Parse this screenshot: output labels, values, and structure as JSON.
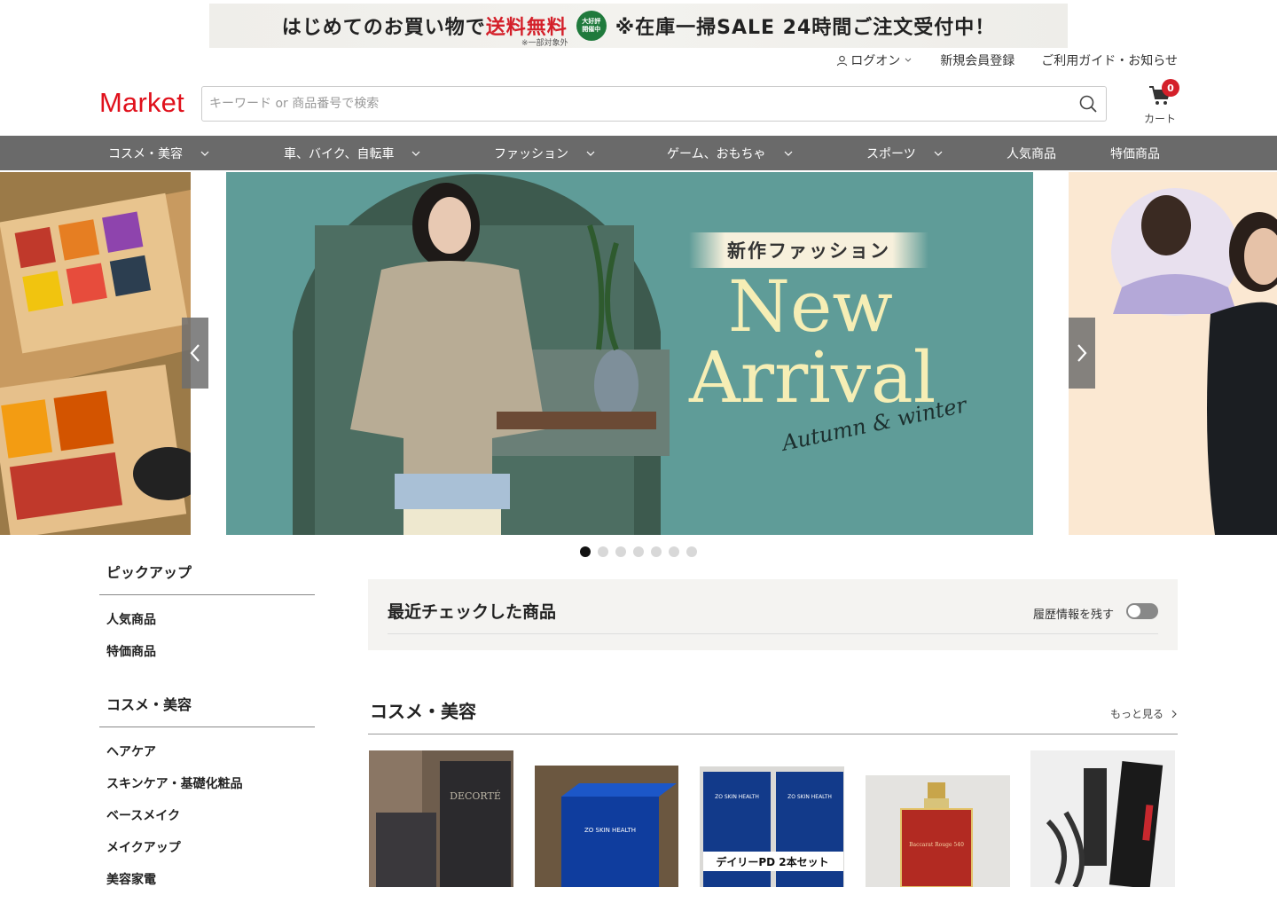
{
  "promo": {
    "text_prefix": "はじめてのお買い物で",
    "text_red": "送料無料",
    "note": "※一部対象外",
    "badge_line1": "大好評",
    "badge_line2": "開催中",
    "text_sale": "※在庫一掃SALE 24時間ご注文受付中！"
  },
  "header": {
    "login": "ログオン",
    "register": "新規会員登録",
    "guide": "ご利用ガイド・お知らせ",
    "logo": "Market",
    "search_placeholder": "キーワード or 商品番号で検索",
    "cart_count": "0",
    "cart_label": "カート"
  },
  "nav": [
    {
      "label": "コスメ・美容",
      "has_dropdown": true
    },
    {
      "label": "車、バイク、自転車",
      "has_dropdown": true
    },
    {
      "label": "ファッション",
      "has_dropdown": true
    },
    {
      "label": "ゲーム、おもちゃ",
      "has_dropdown": true
    },
    {
      "label": "スポーツ",
      "has_dropdown": true
    },
    {
      "label": "人気商品",
      "has_dropdown": false
    },
    {
      "label": "特価商品",
      "has_dropdown": false
    }
  ],
  "carousel": {
    "main_heading": "新作ファッション",
    "main_title_line1": "New",
    "main_title_line2": "Arrival",
    "main_script": "Autumn & winter",
    "dot_count": 7,
    "active_dot": 0
  },
  "sidebar": {
    "groups": [
      {
        "heading": "ピックアップ",
        "items": [
          "人気商品",
          "特価商品"
        ]
      },
      {
        "heading": "コスメ・美容",
        "items": [
          "ヘアケア",
          "スキンケア・基礎化粧品",
          "ベースメイク",
          "メイクアップ",
          "美容家電"
        ]
      }
    ]
  },
  "recent": {
    "title": "最近チェックした商品",
    "history_label": "履歴情報を残す",
    "history_enabled": false
  },
  "section": {
    "title": "コスメ・美容",
    "more": "もっと見る"
  },
  "products": [
    {
      "brand": "DECORTÉ"
    },
    {
      "brand": "ZO SKIN HEALTH"
    },
    {
      "brand": "ZO SKIN HEALTH",
      "caption": "デイリーPD 2本セット"
    },
    {
      "brand": "Baccarat Rouge 540"
    },
    {
      "brand": ""
    }
  ]
}
